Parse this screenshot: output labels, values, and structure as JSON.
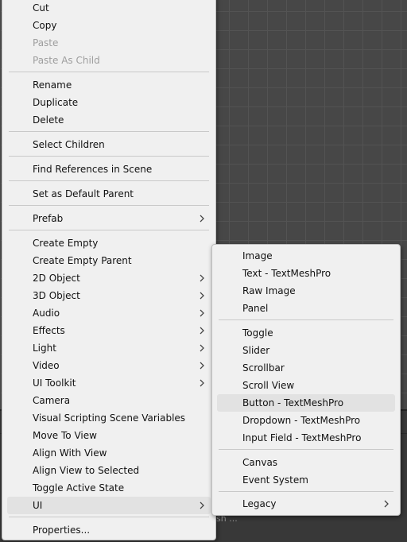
{
  "context_menu": {
    "items": [
      {
        "label": "Cut",
        "enabled": true
      },
      {
        "label": "Copy",
        "enabled": true
      },
      {
        "label": "Paste",
        "enabled": false
      },
      {
        "label": "Paste As Child",
        "enabled": false
      },
      {
        "label": "Rename",
        "enabled": true
      },
      {
        "label": "Duplicate",
        "enabled": true
      },
      {
        "label": "Delete",
        "enabled": true
      },
      {
        "label": "Select Children",
        "enabled": true
      },
      {
        "label": "Find References in Scene",
        "enabled": true
      },
      {
        "label": "Set as Default Parent",
        "enabled": true
      },
      {
        "label": "Prefab",
        "enabled": true,
        "submenu": true
      },
      {
        "label": "Create Empty",
        "enabled": true
      },
      {
        "label": "Create Empty Parent",
        "enabled": true
      },
      {
        "label": "2D Object",
        "enabled": true,
        "submenu": true
      },
      {
        "label": "3D Object",
        "enabled": true,
        "submenu": true
      },
      {
        "label": "Audio",
        "enabled": true,
        "submenu": true
      },
      {
        "label": "Effects",
        "enabled": true,
        "submenu": true
      },
      {
        "label": "Light",
        "enabled": true,
        "submenu": true
      },
      {
        "label": "Video",
        "enabled": true,
        "submenu": true
      },
      {
        "label": "UI Toolkit",
        "enabled": true,
        "submenu": true
      },
      {
        "label": "Camera",
        "enabled": true
      },
      {
        "label": "Visual Scripting Scene Variables",
        "enabled": true
      },
      {
        "label": "Move To View",
        "enabled": true
      },
      {
        "label": "Align With View",
        "enabled": true
      },
      {
        "label": "Align View to Selected",
        "enabled": true
      },
      {
        "label": "Toggle Active State",
        "enabled": true
      },
      {
        "label": "UI",
        "enabled": true,
        "submenu": true,
        "highlighted": true
      },
      {
        "label": "Properties...",
        "enabled": true
      }
    ]
  },
  "ui_submenu": {
    "items": [
      {
        "label": "Image"
      },
      {
        "label": "Text - TextMeshPro"
      },
      {
        "label": "Raw Image"
      },
      {
        "label": "Panel"
      },
      {
        "label": "Toggle"
      },
      {
        "label": "Slider"
      },
      {
        "label": "Scrollbar"
      },
      {
        "label": "Scroll View"
      },
      {
        "label": "Button - TextMeshPro",
        "highlighted": true
      },
      {
        "label": "Dropdown - TextMeshPro"
      },
      {
        "label": "Input Field - TextMeshPro"
      },
      {
        "label": "Canvas"
      },
      {
        "label": "Event System"
      },
      {
        "label": "Legacy",
        "submenu": true
      }
    ]
  },
  "background": {
    "hint_text": "sh ..."
  },
  "colors": {
    "menu_bg": "#f0f0f0",
    "highlight": "#e2e2e2",
    "disabled_text": "#9e9e9e",
    "scene_bg": "#474747"
  }
}
